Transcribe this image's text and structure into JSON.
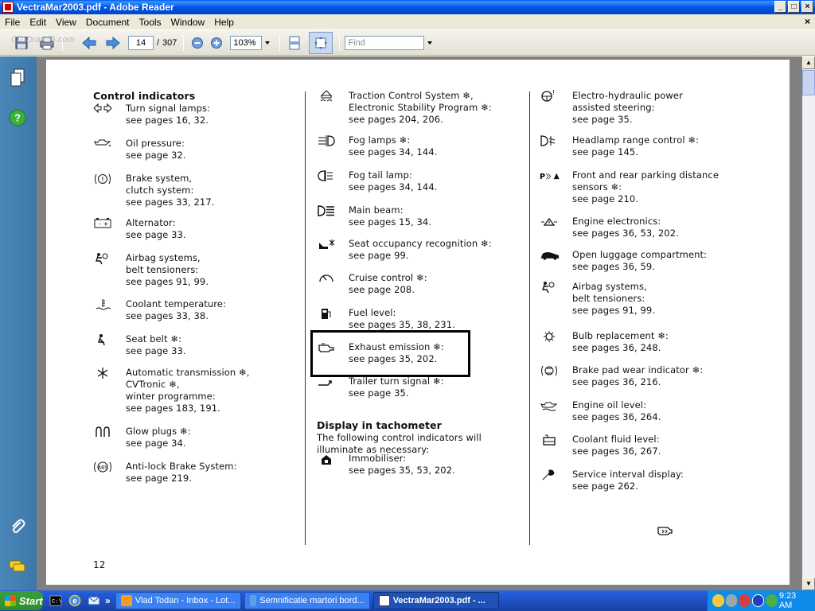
{
  "window": {
    "title": "VectraMar2003.pdf - Adobe Reader",
    "btn_min": "_",
    "btn_max": "□",
    "btn_close": "×"
  },
  "menu": {
    "items": [
      "File",
      "Edit",
      "View",
      "Document",
      "Tools",
      "Window",
      "Help"
    ],
    "close": "×"
  },
  "toolbar": {
    "page_current": "14",
    "page_sep": "/",
    "page_total": "307",
    "zoom": "103%",
    "find_placeholder": "Find"
  },
  "watermark": "ClipDraw@.com",
  "document": {
    "page_number": "12",
    "col1": {
      "heading": "Control indicators",
      "entries": [
        {
          "icon": "turn-signal-icon",
          "lines": [
            "Turn signal lamps:",
            "see pages 16, 32."
          ]
        },
        {
          "icon": "oil-pressure-icon",
          "lines": [
            "Oil pressure:",
            "see page 32."
          ]
        },
        {
          "icon": "brake-system-icon",
          "lines": [
            "Brake system,",
            "clutch system:",
            "see pages 33, 217."
          ]
        },
        {
          "icon": "alternator-icon",
          "lines": [
            "Alternator:",
            "see page 33."
          ]
        },
        {
          "icon": "airbag-icon",
          "lines": [
            "Airbag systems,",
            "belt tensioners:",
            "see pages 91, 99."
          ]
        },
        {
          "icon": "coolant-temperature-icon",
          "lines": [
            "Coolant temperature:",
            "see pages 33, 38."
          ]
        },
        {
          "icon": "seat-belt-icon",
          "lines": [
            "Seat belt ❄:",
            "see page 33."
          ]
        },
        {
          "icon": "snowflake-icon",
          "lines": [
            "Automatic transmission ❄,",
            "CVTronic ❄,",
            "winter programme:",
            "see pages 183, 191."
          ]
        },
        {
          "icon": "glow-plugs-icon",
          "lines": [
            "Glow plugs ❄:",
            "see page 34."
          ]
        },
        {
          "icon": "abs-icon",
          "lines": [
            "Anti-lock Brake System:",
            "see page 219."
          ]
        }
      ]
    },
    "col2": {
      "entries": [
        {
          "icon": "traction-control-icon",
          "lines": [
            "Traction Control System ❄,",
            "Electronic Stability Program ❄:",
            "see pages 204, 206."
          ]
        },
        {
          "icon": "fog-lamps-icon",
          "lines": [
            "Fog lamps ❄:",
            "see pages 34, 144."
          ]
        },
        {
          "icon": "fog-tail-lamp-icon",
          "lines": [
            "Fog tail lamp:",
            "see pages 34, 144."
          ]
        },
        {
          "icon": "main-beam-icon",
          "lines": [
            "Main beam:",
            "see pages 15, 34."
          ]
        },
        {
          "icon": "seat-occupancy-icon",
          "lines": [
            "Seat occupancy recognition ❄:",
            "see page 99."
          ]
        },
        {
          "icon": "cruise-control-icon",
          "lines": [
            "Cruise control ❄:",
            "see page 208."
          ]
        },
        {
          "icon": "fuel-level-icon",
          "lines": [
            "Fuel level:",
            "see pages 35, 38, 231."
          ]
        },
        {
          "icon": "exhaust-emission-icon",
          "lines": [
            "Exhaust emission ❄:",
            "see pages 35, 202."
          ]
        },
        {
          "icon": "trailer-signal-icon",
          "lines": [
            "Trailer turn signal ❄:",
            "see page 35."
          ]
        }
      ],
      "tacho_heading": "Display in tachometer",
      "tacho_text": [
        "The following control indicators will",
        "illuminate as necessary:"
      ],
      "immobiliser": {
        "icon": "immobiliser-icon",
        "lines": [
          "Immobiliser:",
          "see pages 35, 53, 202."
        ]
      }
    },
    "col3": {
      "entries": [
        {
          "icon": "power-steering-icon",
          "lines": [
            "Electro-hydraulic power",
            "assisted steering:",
            "see page 35."
          ]
        },
        {
          "icon": "headlamp-range-icon",
          "lines": [
            "Headlamp range control ❄:",
            "see page 145."
          ]
        },
        {
          "icon": "parking-distance-icon",
          "lines": [
            "Front and rear parking distance",
            "sensors ❄:",
            "see page 210."
          ]
        },
        {
          "icon": "engine-electronics-icon",
          "lines": [
            "Engine electronics:",
            "see pages 36, 53, 202."
          ]
        },
        {
          "icon": "luggage-compartment-icon",
          "lines": [
            "Open luggage compartment:",
            "see pages 36, 59."
          ]
        },
        {
          "icon": "airbag-icon",
          "lines": [
            "Airbag systems,",
            "belt tensioners:",
            "see pages 91, 99."
          ]
        },
        {
          "icon": "bulb-replacement-icon",
          "lines": [
            "Bulb replacement ❄:",
            "see pages 36, 248."
          ]
        },
        {
          "icon": "brake-pad-wear-icon",
          "lines": [
            "Brake pad wear indicator ❄:",
            "see pages 36, 216."
          ]
        },
        {
          "icon": "engine-oil-level-icon",
          "lines": [
            "Engine oil level:",
            "see pages 36, 264."
          ]
        },
        {
          "icon": "coolant-fluid-icon",
          "lines": [
            "Coolant fluid level:",
            "see pages 36, 267."
          ]
        },
        {
          "icon": "service-interval-icon",
          "lines": [
            "Service interval display:",
            "see page 262."
          ]
        }
      ]
    }
  },
  "taskbar": {
    "start": "Start",
    "tasks": [
      "Vlad Todan - Inbox - Lot...",
      "Semnificatie martori bord...",
      "VectraMar2003.pdf - ..."
    ],
    "clock": "9:23 AM",
    "overflow": "»"
  }
}
